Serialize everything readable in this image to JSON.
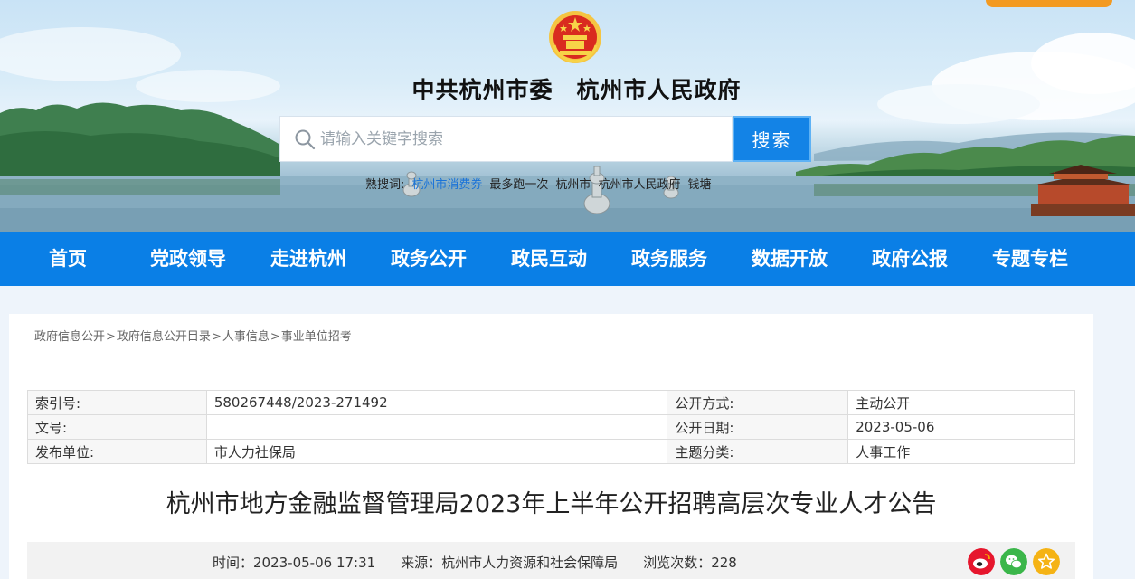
{
  "header": {
    "title": "中共杭州市委　杭州市人民政府",
    "emblem_icon": "national-emblem-icon"
  },
  "search": {
    "placeholder": "请输入关键字搜索",
    "button_label": "搜索",
    "icon": "search-icon",
    "hot_words": [
      "熟搜词:",
      "杭州市消费券",
      "最多跑一次",
      "杭州市",
      "杭州市人民政府",
      "钱塘"
    ]
  },
  "nav": {
    "items": [
      "首页",
      "党政领导",
      "走进杭州",
      "政务公开",
      "政民互动",
      "政务服务",
      "数据开放",
      "政府公报",
      "专题专栏"
    ]
  },
  "breadcrumb": [
    "政府信息公开",
    "政府信息公开目录",
    "人事信息",
    "事业单位招考"
  ],
  "info": {
    "rows": [
      [
        "索引号:",
        "580267448/2023-271492",
        "公开方式:",
        "主动公开"
      ],
      [
        "文号:",
        "",
        "公开日期:",
        "2023-05-06"
      ],
      [
        "发布单位:",
        "市人力社保局",
        "主题分类:",
        "人事工作"
      ]
    ]
  },
  "article": {
    "title": "杭州市地方金融监督管理局2023年上半年公开招聘高层次专业人才公告",
    "time": "时间：2023-05-06 17:31",
    "source": "来源：杭州市人力资源和社会保障局",
    "views": "浏览次数：228"
  },
  "share": {
    "icons": [
      "weibo-icon",
      "wechat-icon",
      "favorite-icon"
    ]
  },
  "colors": {
    "nav_bg": "#0a7fe6",
    "search_button": "#1383e6",
    "accent_orange": "#f39a21",
    "hot_link": "#1a73d8"
  }
}
